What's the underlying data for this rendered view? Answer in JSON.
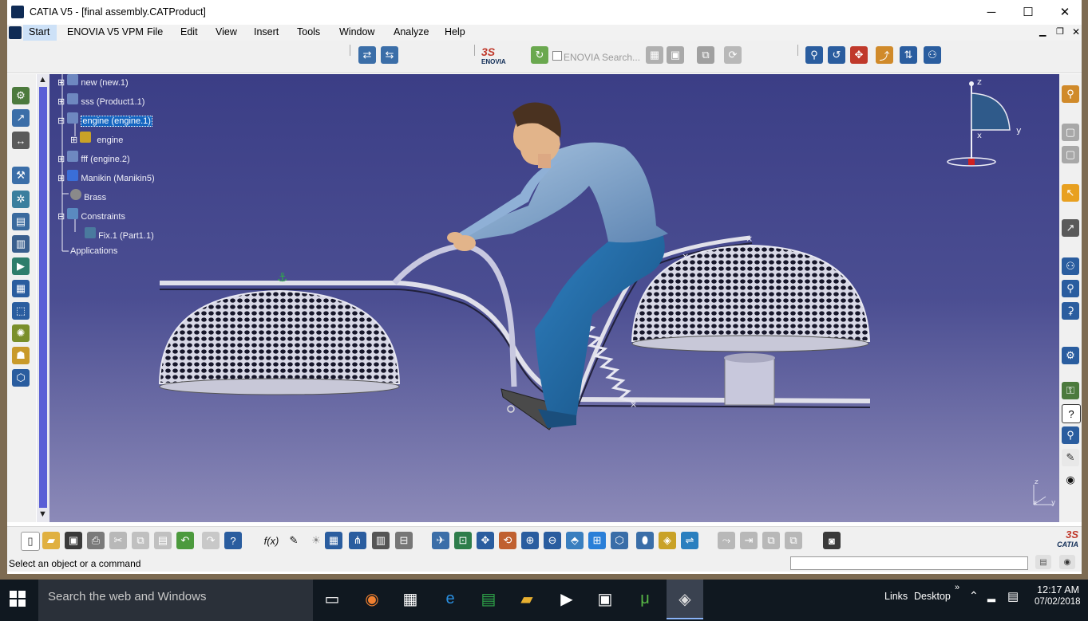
{
  "window": {
    "title": "CATIA V5 - [final assembly.CATProduct]",
    "minimize": "─",
    "maximize": "☐",
    "close": "✕"
  },
  "menu": [
    "Start",
    "ENOVIA V5 VPM",
    "File",
    "Edit",
    "View",
    "Insert",
    "Tools",
    "Window",
    "Analyze",
    "Help"
  ],
  "toolbar_top": {
    "enovia_logo": "ENOVIA",
    "enovia_search_label": "ENOVIA Search..."
  },
  "tree": [
    {
      "label": "new (new.1)"
    },
    {
      "label": "sss (Product1.1)"
    },
    {
      "label": "engine (engine.1)",
      "selected": true
    },
    {
      "label": "engine"
    },
    {
      "label": "fff (engine.2)"
    },
    {
      "label": "Manikin (Manikin5)"
    },
    {
      "label": "Brass"
    },
    {
      "label": "Constraints"
    },
    {
      "label": "Fix.1 (Part1.1)"
    },
    {
      "label": "Applications"
    }
  ],
  "compass": {
    "z": "z",
    "y": "y",
    "x": "x"
  },
  "axis_triad": {
    "z": "z",
    "x": "x",
    "y": "y"
  },
  "status": {
    "prompt": "Select an object or a command"
  },
  "catia_logo": "CATIA",
  "taskbar": {
    "search_placeholder": "Search the web and Windows",
    "links": "Links",
    "desktop": "Desktop",
    "chevron": "»",
    "time": "12:17 AM",
    "date": "07/02/2018"
  },
  "colors": {
    "viewport_top": "#3b3e86",
    "viewport_bottom": "#8c8ab8",
    "selection": "#1565c0"
  }
}
